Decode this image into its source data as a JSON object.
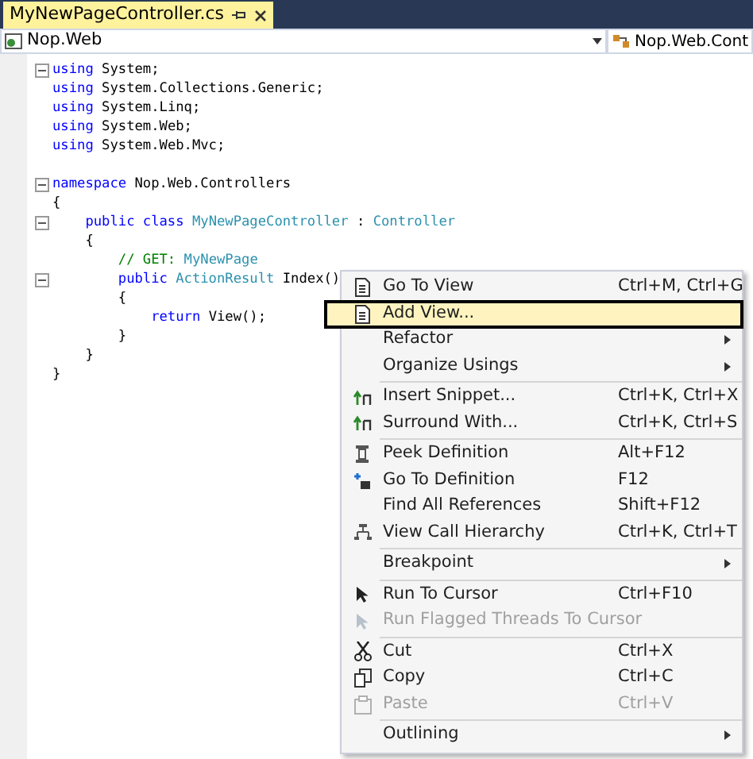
{
  "tab": {
    "title": "MyNewPageController.cs",
    "selected": true
  },
  "nav": {
    "project": "Nop.Web",
    "class_dropdown": "Nop.Web.Cont"
  },
  "code_lines": [
    {
      "fold": true,
      "tokens": [
        {
          "kind": "keyword",
          "text": "using"
        },
        {
          "kind": "plain",
          "text": " System;"
        }
      ]
    },
    {
      "fold": false,
      "tokens": [
        {
          "kind": "keyword",
          "text": "using"
        },
        {
          "kind": "plain",
          "text": " System.Collections.Generic;"
        }
      ]
    },
    {
      "fold": false,
      "tokens": [
        {
          "kind": "keyword",
          "text": "using"
        },
        {
          "kind": "plain",
          "text": " System.Linq;"
        }
      ]
    },
    {
      "fold": false,
      "tokens": [
        {
          "kind": "keyword",
          "text": "using"
        },
        {
          "kind": "plain",
          "text": " System.Web;"
        }
      ]
    },
    {
      "fold": false,
      "tokens": [
        {
          "kind": "keyword",
          "text": "using"
        },
        {
          "kind": "plain",
          "text": " System.Web.Mvc;"
        }
      ]
    },
    {
      "fold": false
    },
    {
      "fold": true,
      "tokens": [
        {
          "kind": "keyword",
          "text": "namespace"
        },
        {
          "kind": "plain",
          "text": " Nop.Web.Controllers"
        }
      ]
    },
    {
      "fold": false,
      "tokens": [
        {
          "kind": "plain",
          "text": "{"
        }
      ]
    },
    {
      "fold": true,
      "tokens": [
        {
          "kind": "keyword",
          "text": "    public class "
        },
        {
          "kind": "type",
          "text": "MyNewPageController"
        },
        {
          "kind": "plain",
          "text": " : "
        },
        {
          "kind": "type",
          "text": "Controller"
        }
      ]
    },
    {
      "fold": false,
      "tokens": [
        {
          "kind": "plain",
          "text": "    {"
        }
      ]
    },
    {
      "fold": false,
      "tokens": [
        {
          "kind": "comment",
          "text": "        // GET: "
        },
        {
          "kind": "type",
          "text": "MyNewPage"
        }
      ]
    },
    {
      "fold": true,
      "tokens": [
        {
          "kind": "keyword",
          "text": "        public "
        },
        {
          "kind": "type",
          "text": "ActionResult"
        },
        {
          "kind": "plain",
          "text": " Index()"
        }
      ]
    },
    {
      "fold": false,
      "tokens": [
        {
          "kind": "plain",
          "text": "        {"
        }
      ]
    },
    {
      "fold": false,
      "tokens": [
        {
          "kind": "keyword",
          "text": "            return"
        },
        {
          "kind": "plain",
          "text": " View();"
        }
      ]
    },
    {
      "fold": false,
      "tokens": [
        {
          "kind": "plain",
          "text": "        }"
        }
      ]
    },
    {
      "fold": false,
      "tokens": [
        {
          "kind": "plain",
          "text": "    }"
        }
      ]
    },
    {
      "fold": false,
      "tokens": [
        {
          "kind": "plain",
          "text": "}"
        }
      ]
    }
  ],
  "context_menu": [
    {
      "kind": "item",
      "label": "Go To View",
      "shortcut": "Ctrl+M, Ctrl+G",
      "selected": false,
      "disabled": false,
      "submenu": false
    },
    {
      "kind": "item",
      "label": "Add View...",
      "selected": true,
      "disabled": false,
      "submenu": false
    },
    {
      "kind": "item",
      "label": "Refactor",
      "selected": false,
      "disabled": false,
      "submenu": true
    },
    {
      "kind": "item",
      "label": "Organize Usings",
      "selected": false,
      "disabled": false,
      "submenu": true
    },
    {
      "kind": "separator"
    },
    {
      "kind": "item",
      "label": "Insert Snippet...",
      "shortcut": "Ctrl+K, Ctrl+X",
      "selected": false,
      "disabled": false,
      "submenu": false
    },
    {
      "kind": "item",
      "label": "Surround With...",
      "shortcut": "Ctrl+K, Ctrl+S",
      "selected": false,
      "disabled": false,
      "submenu": false
    },
    {
      "kind": "separator"
    },
    {
      "kind": "item",
      "label": "Peek Definition",
      "shortcut": "Alt+F12",
      "selected": false,
      "disabled": false,
      "submenu": false
    },
    {
      "kind": "item",
      "label": "Go To Definition",
      "shortcut": "F12",
      "selected": false,
      "disabled": false,
      "submenu": false
    },
    {
      "kind": "item",
      "label": "Find All References",
      "shortcut": "Shift+F12",
      "selected": false,
      "disabled": false,
      "submenu": false
    },
    {
      "kind": "item",
      "label": "View Call Hierarchy",
      "shortcut": "Ctrl+K, Ctrl+T",
      "selected": false,
      "disabled": false,
      "submenu": false
    },
    {
      "kind": "separator"
    },
    {
      "kind": "item",
      "label": "Breakpoint",
      "selected": false,
      "disabled": false,
      "submenu": true
    },
    {
      "kind": "separator"
    },
    {
      "kind": "item",
      "label": "Run To Cursor",
      "shortcut": "Ctrl+F10",
      "selected": false,
      "disabled": false,
      "submenu": false
    },
    {
      "kind": "item",
      "label": "Run Flagged Threads To Cursor",
      "selected": false,
      "disabled": true,
      "submenu": false
    },
    {
      "kind": "separator"
    },
    {
      "kind": "item",
      "label": "Cut",
      "shortcut": "Ctrl+X",
      "selected": false,
      "disabled": false,
      "submenu": false
    },
    {
      "kind": "item",
      "label": "Copy",
      "shortcut": "Ctrl+C",
      "selected": false,
      "disabled": false,
      "submenu": false
    },
    {
      "kind": "item",
      "label": "Paste",
      "shortcut": "Ctrl+V",
      "selected": false,
      "disabled": true,
      "submenu": false
    },
    {
      "kind": "separator"
    },
    {
      "kind": "item",
      "label": "Outlining",
      "selected": false,
      "disabled": false,
      "submenu": true
    }
  ]
}
